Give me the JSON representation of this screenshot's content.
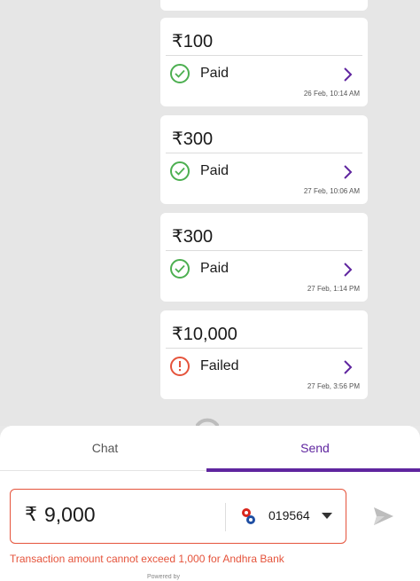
{
  "transactions": [
    {
      "amount": "₹100",
      "status": "Paid",
      "timestamp": "26 Feb, 10:14 AM"
    },
    {
      "amount": "₹300",
      "status": "Paid",
      "timestamp": "27 Feb, 10:06 AM"
    },
    {
      "amount": "₹300",
      "status": "Paid",
      "timestamp": "27 Feb, 1:14 PM"
    },
    {
      "amount": "₹10,000",
      "status": "Failed",
      "timestamp": "27 Feb, 3:56 PM"
    }
  ],
  "tabs": {
    "chat": "Chat",
    "send": "Send"
  },
  "payment": {
    "currency_symbol": "₹",
    "amount": "9,000",
    "account": "019564",
    "error": "Transaction amount cannot exceed 1,000 for Andhra Bank"
  },
  "footer": {
    "powered_by": "Powered by"
  },
  "icons": {
    "paid": "check-circle-icon",
    "failed": "exclamation-circle-icon",
    "detail": "chevron-right-icon",
    "send": "send-icon",
    "bank": "andhra-bank-logo-icon"
  },
  "colors": {
    "accent": "#5f259f",
    "success": "#4caf50",
    "error": "#e5533b"
  }
}
